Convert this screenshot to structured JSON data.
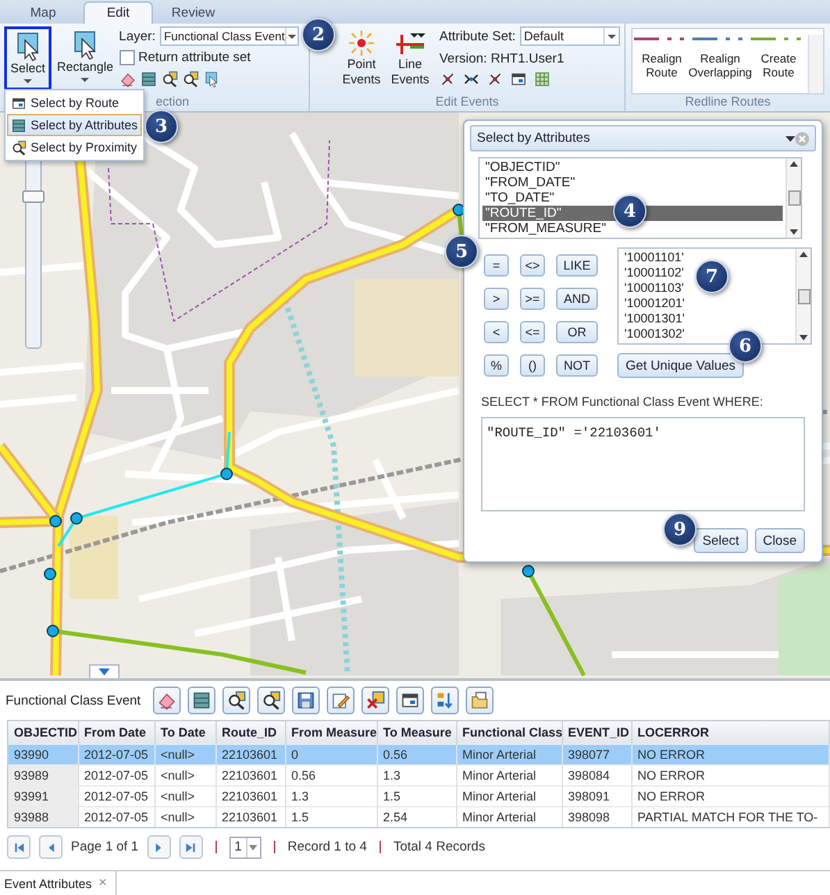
{
  "tabs": [
    {
      "label": "Map",
      "selected": false
    },
    {
      "label": "Edit",
      "selected": true
    },
    {
      "label": "Review",
      "selected": false
    }
  ],
  "ribbon": {
    "select_button": {
      "label": "Select",
      "selected": true
    },
    "rectangle_button": {
      "label": "Rectangle"
    },
    "layer": {
      "label": "Layer:",
      "value": "Functional Class Event"
    },
    "return_attribute_set": {
      "label": "Return attribute set",
      "checked": false
    },
    "selection_group_label": "ection",
    "point_events": {
      "label": "Point Events"
    },
    "line_events": {
      "label": "Line Events"
    },
    "attribute_set": {
      "label": "Attribute Set:",
      "value": "Default"
    },
    "version": "Version: RHT1.User1",
    "edit_events_label": "Edit Events",
    "redline_tools": [
      {
        "label": "Realign Route",
        "color": "#b0407a"
      },
      {
        "label": "Realign Overlapping",
        "color": "#4a7fc0"
      },
      {
        "label": "Create Route",
        "color": "#78b030"
      }
    ],
    "redline_label": "Redline Routes"
  },
  "select_menu": [
    {
      "label": "Select by Route",
      "selected": false
    },
    {
      "label": "Select by Attributes",
      "selected": true
    },
    {
      "label": "Select by Proximity",
      "selected": false
    }
  ],
  "map": {
    "zoom_slider": {
      "level": 0.8
    }
  },
  "dialog": {
    "title": "Select by Attributes",
    "fields": [
      {
        "label": "\"OBJECTID\"",
        "selected": false
      },
      {
        "label": "\"FROM_DATE\"",
        "selected": false
      },
      {
        "label": "\"TO_DATE\"",
        "selected": false
      },
      {
        "label": "\"ROUTE_ID\"",
        "selected": true
      },
      {
        "label": "\"FROM_MEASURE\"",
        "selected": false
      }
    ],
    "operators": [
      "=",
      "<>",
      "LIKE",
      ">",
      ">=",
      "AND",
      "<",
      "<=",
      "OR",
      "%",
      "()",
      "NOT"
    ],
    "values": [
      "'10001101'",
      "'10001102'",
      "'10001103'",
      "'10001201'",
      "'10001301'",
      "'10001302'"
    ],
    "get_unique_values": "Get Unique Values",
    "where_label": "SELECT * FROM Functional Class Event WHERE:",
    "expression": "\"ROUTE_ID\" ='22103601'",
    "buttons": [
      "Select",
      "Close"
    ]
  },
  "callouts": [
    "2",
    "3",
    "4",
    "5",
    "6",
    "7",
    "9"
  ],
  "table_panel": {
    "title": "Functional Class Event",
    "columns": [
      "OBJECTID",
      "From Date",
      "To Date",
      "Route_ID",
      "From Measure",
      "To Measure",
      "Functional Class",
      "EVENT_ID",
      "LOCERROR"
    ],
    "rows": [
      {
        "selected": true,
        "cells": [
          "93990",
          "2012-07-05",
          "<null>",
          "22103601",
          "0",
          "0.56",
          "Minor Arterial",
          "398077",
          "NO ERROR"
        ]
      },
      {
        "selected": false,
        "cells": [
          "93989",
          "2012-07-05",
          "<null>",
          "22103601",
          "0.56",
          "1.3",
          "Minor Arterial",
          "398084",
          "NO ERROR"
        ]
      },
      {
        "selected": false,
        "cells": [
          "93991",
          "2012-07-05",
          "<null>",
          "22103601",
          "1.3",
          "1.5",
          "Minor Arterial",
          "398091",
          "NO ERROR"
        ]
      },
      {
        "selected": false,
        "cells": [
          "93988",
          "2012-07-05",
          "<null>",
          "22103601",
          "1.5",
          "2.54",
          "Minor Arterial",
          "398098",
          "PARTIAL MATCH FOR THE TO-"
        ]
      }
    ],
    "pager": {
      "page_text": "Page 1 of 1",
      "page_select": "1",
      "record_text": "Record 1 to 4",
      "total_text": "Total 4 Records"
    },
    "bottom_tab": {
      "label": "Event Attributes",
      "close": "×"
    }
  }
}
